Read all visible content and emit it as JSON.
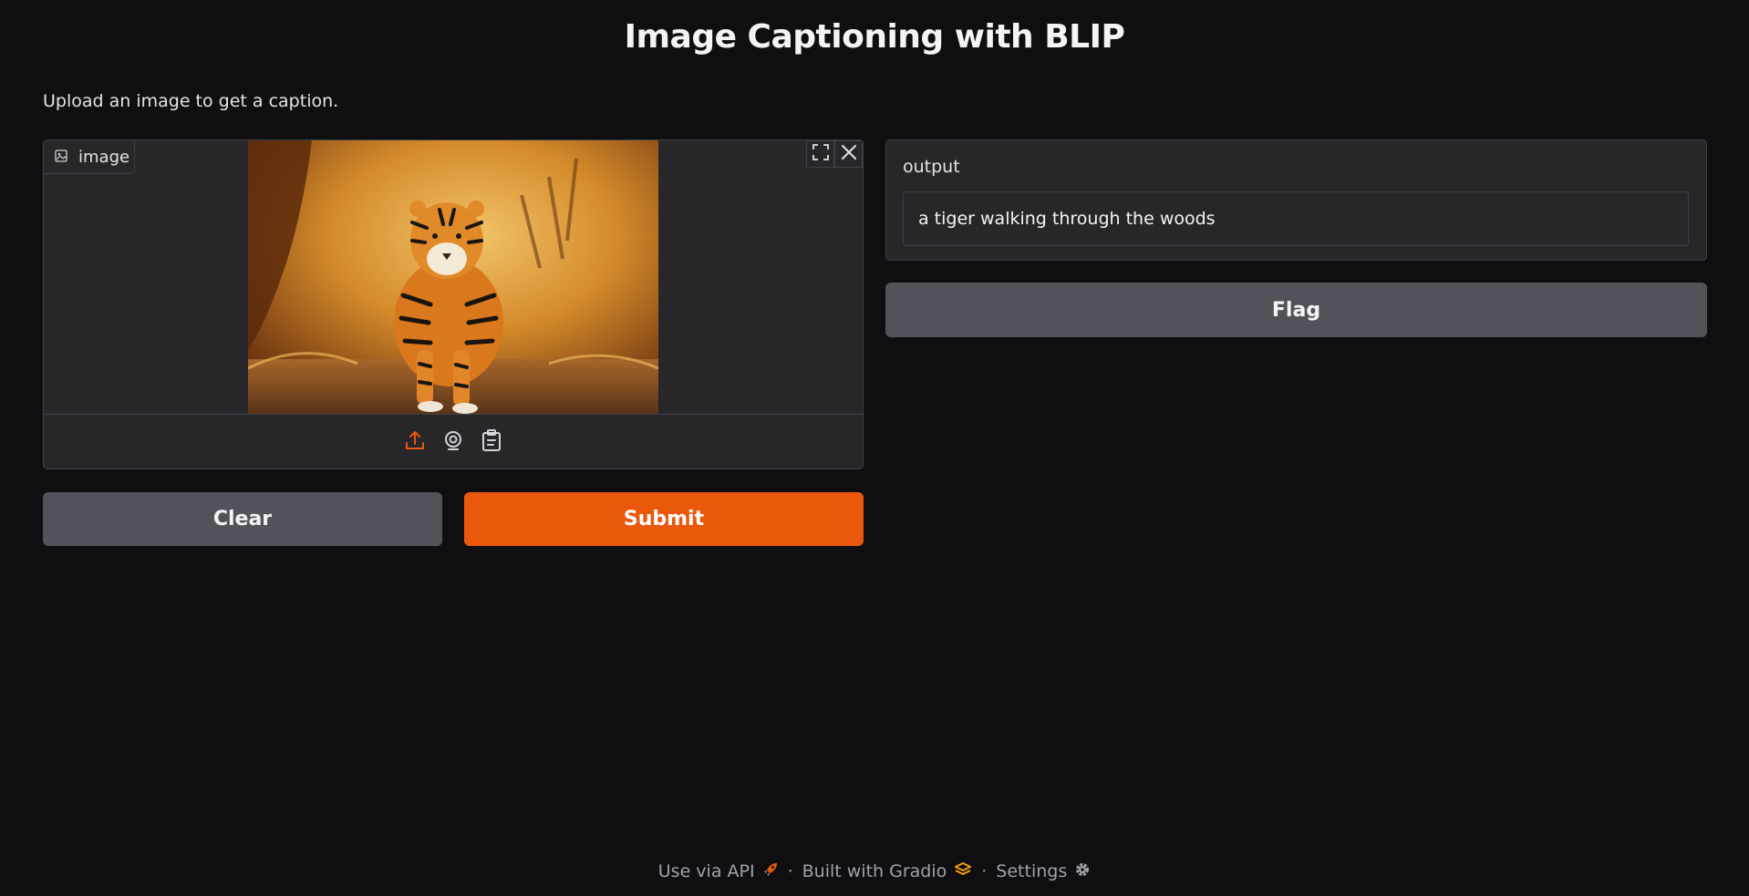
{
  "page": {
    "title": "Image Captioning with BLIP",
    "description": "Upload an image to get a caption."
  },
  "input": {
    "label": "image",
    "icons": [
      "image-icon",
      "fullscreen-icon",
      "close-icon",
      "upload-icon",
      "webcam-icon",
      "clipboard-icon"
    ]
  },
  "buttons": {
    "clear": "Clear",
    "submit": "Submit",
    "flag": "Flag"
  },
  "output": {
    "label": "output",
    "value": "a tiger walking through the woods"
  },
  "footer": {
    "api": "Use via API",
    "built": "Built with Gradio",
    "settings": "Settings",
    "separator": "·"
  },
  "colors": {
    "background": "#0f0f11",
    "panel": "#27272a",
    "primary": "#ea580c",
    "secondary": "#52525b"
  }
}
